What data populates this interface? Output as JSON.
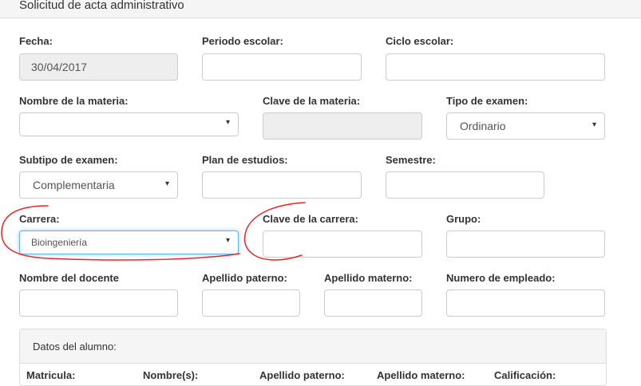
{
  "panel": {
    "title": "Solicitud de acta administrativo"
  },
  "fields": {
    "fecha": {
      "label": "Fecha:",
      "value": "30/04/2017"
    },
    "periodo": {
      "label": "Periodo escolar:",
      "value": ""
    },
    "ciclo": {
      "label": "Ciclo escolar:",
      "value": ""
    },
    "materia": {
      "label": "Nombre de la materia:",
      "value": ""
    },
    "clave_materia": {
      "label": "Clave de la materia:",
      "value": ""
    },
    "tipo_examen": {
      "label": "Tipo de examen:",
      "value": "Ordinario"
    },
    "subtipo_examen": {
      "label": "Subtipo de examen:",
      "value": "Complementaria"
    },
    "plan": {
      "label": "Plan de estudios:",
      "value": ""
    },
    "semestre": {
      "label": "Semestre:",
      "value": ""
    },
    "carrera": {
      "label": "Carrera:",
      "value": "Bioingeniería"
    },
    "clave_carrera": {
      "label": "Clave de la carrera:",
      "value": ""
    },
    "grupo": {
      "label": "Grupo:",
      "value": ""
    },
    "docente": {
      "label": "Nombre del docente",
      "value": ""
    },
    "paterno": {
      "label": "Apellido paterno:",
      "value": ""
    },
    "materno": {
      "label": "Apellido materno:",
      "value": ""
    },
    "empleado": {
      "label": "Numero de empleado:",
      "value": ""
    }
  },
  "alumno": {
    "title": "Datos del alumno:",
    "columns": [
      "Matricula:",
      "Nombre(s):",
      "Apellido paterno:",
      "Apellido materno:",
      "Calificación:"
    ]
  },
  "icons": {
    "select_caret": "▾"
  },
  "annotation_color": "#e8262a"
}
